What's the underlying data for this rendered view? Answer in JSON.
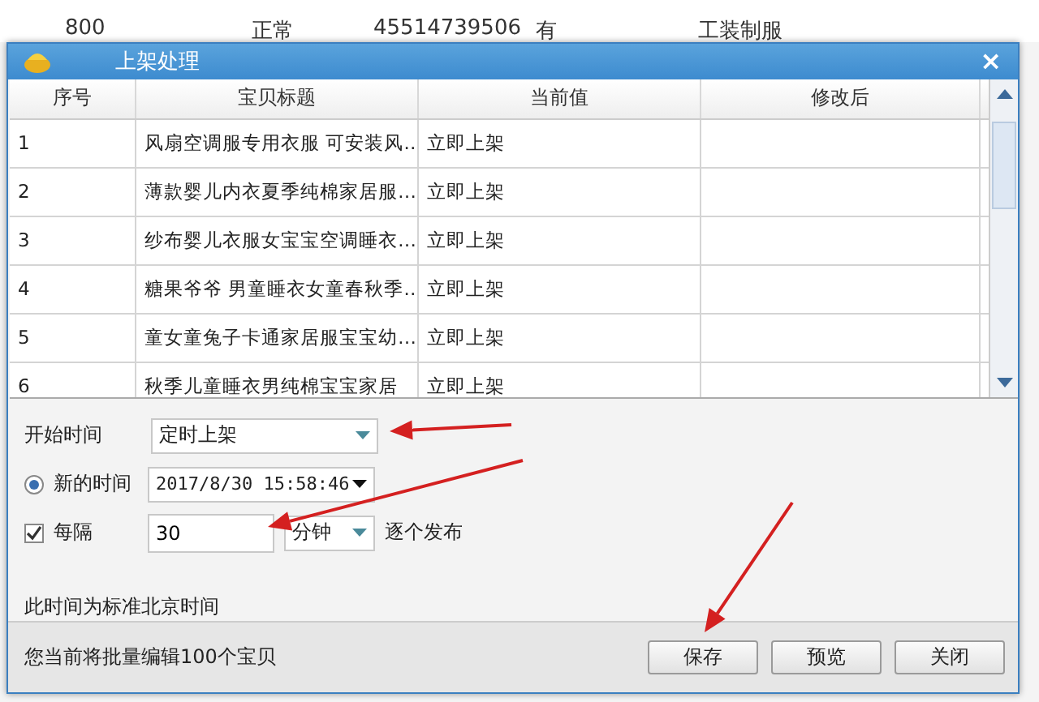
{
  "background_row": [
    "800",
    "正常",
    "45514739506",
    "有",
    "工装制服"
  ],
  "dialog": {
    "title": "上架处理",
    "close": "×",
    "table": {
      "columns": [
        "序号",
        "宝贝标题",
        "当前值",
        "修改后"
      ],
      "rows": [
        {
          "no": "1",
          "title": "风扇空调服专用衣服 可安装风…",
          "current": "立即上架"
        },
        {
          "no": "2",
          "title": "薄款婴儿内衣夏季纯棉家居服…",
          "current": "立即上架"
        },
        {
          "no": "3",
          "title": "纱布婴儿衣服女宝宝空调睡衣…",
          "current": "立即上架"
        },
        {
          "no": "4",
          "title": "糖果爷爷 男童睡衣女童春秋季…",
          "current": "立即上架"
        },
        {
          "no": "5",
          "title": "童女童兔子卡通家居服宝宝幼…",
          "current": "立即上架"
        },
        {
          "no": "6",
          "title": "秋季儿童睡衣男纯棉宝宝家居",
          "current": "立即上架"
        }
      ]
    },
    "start": {
      "label": "开始时间",
      "value": "定时上架"
    },
    "new_time": {
      "label": "新的时间",
      "selected": true,
      "value": "2017/8/30 15:58:46"
    },
    "interval": {
      "label": "每隔",
      "checked": true,
      "value": "30",
      "unit": "分钟",
      "suffix": "逐个发布"
    },
    "note": "此时间为标准北京时间",
    "status": "您当前将批量编辑100个宝贝",
    "buttons": [
      "保存",
      "预览",
      "关闭"
    ]
  }
}
